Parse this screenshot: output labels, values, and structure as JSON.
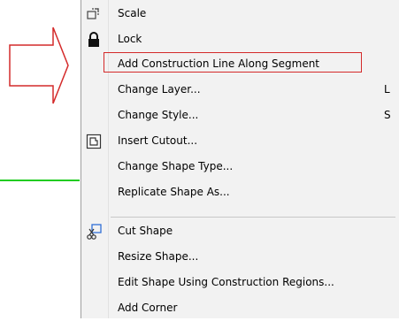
{
  "menu": {
    "items": [
      {
        "label": "Scale",
        "icon": "scale-icon"
      },
      {
        "label": "Lock",
        "icon": "lock-icon"
      },
      {
        "label": "Add Construction Line Along Segment",
        "highlighted": true
      },
      {
        "label": "Change Layer...",
        "shortcut": "L"
      },
      {
        "label": "Change Style...",
        "shortcut": "S"
      },
      {
        "label": "Insert Cutout...",
        "icon": "insert-cutout-icon"
      },
      {
        "label": "Change Shape Type..."
      },
      {
        "label": "Replicate Shape As..."
      },
      {
        "label": "Cut Shape",
        "icon": "cut-shape-icon"
      },
      {
        "label": "Resize Shape..."
      },
      {
        "label": "Edit Shape Using Construction Regions..."
      },
      {
        "label": "Add Corner"
      }
    ]
  },
  "colors": {
    "annotation_red": "#d42a2a",
    "canvas_line_green": "#22cc22",
    "menu_background": "#f2f2f2"
  }
}
